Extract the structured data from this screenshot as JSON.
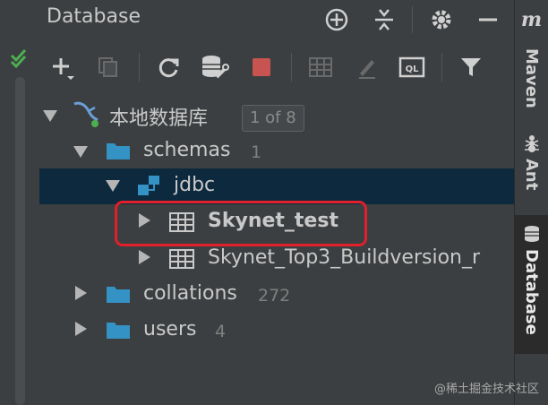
{
  "panel": {
    "title": "Database"
  },
  "tree": {
    "datasource": {
      "label": "本地数据库",
      "pager": "1 of 8"
    },
    "schemas": {
      "label": "schemas",
      "count": "1"
    },
    "schema": {
      "label": "jdbc"
    },
    "tables": [
      {
        "label": "Skynet_test",
        "highlighted": true
      },
      {
        "label": "Skynet_Top3_Buildversion_r"
      }
    ],
    "collations": {
      "label": "collations",
      "count": "272"
    },
    "users": {
      "label": "users",
      "count": "4"
    }
  },
  "right_tabs": {
    "m_letter": "m",
    "maven": "Maven",
    "ant": "Ant",
    "database": "Database"
  },
  "colors": {
    "highlight": "#e0202a",
    "selection": "#0d293e",
    "folder": "#3592c4",
    "stop": "#c75450"
  },
  "watermark": "@稀土掘金技术社区"
}
